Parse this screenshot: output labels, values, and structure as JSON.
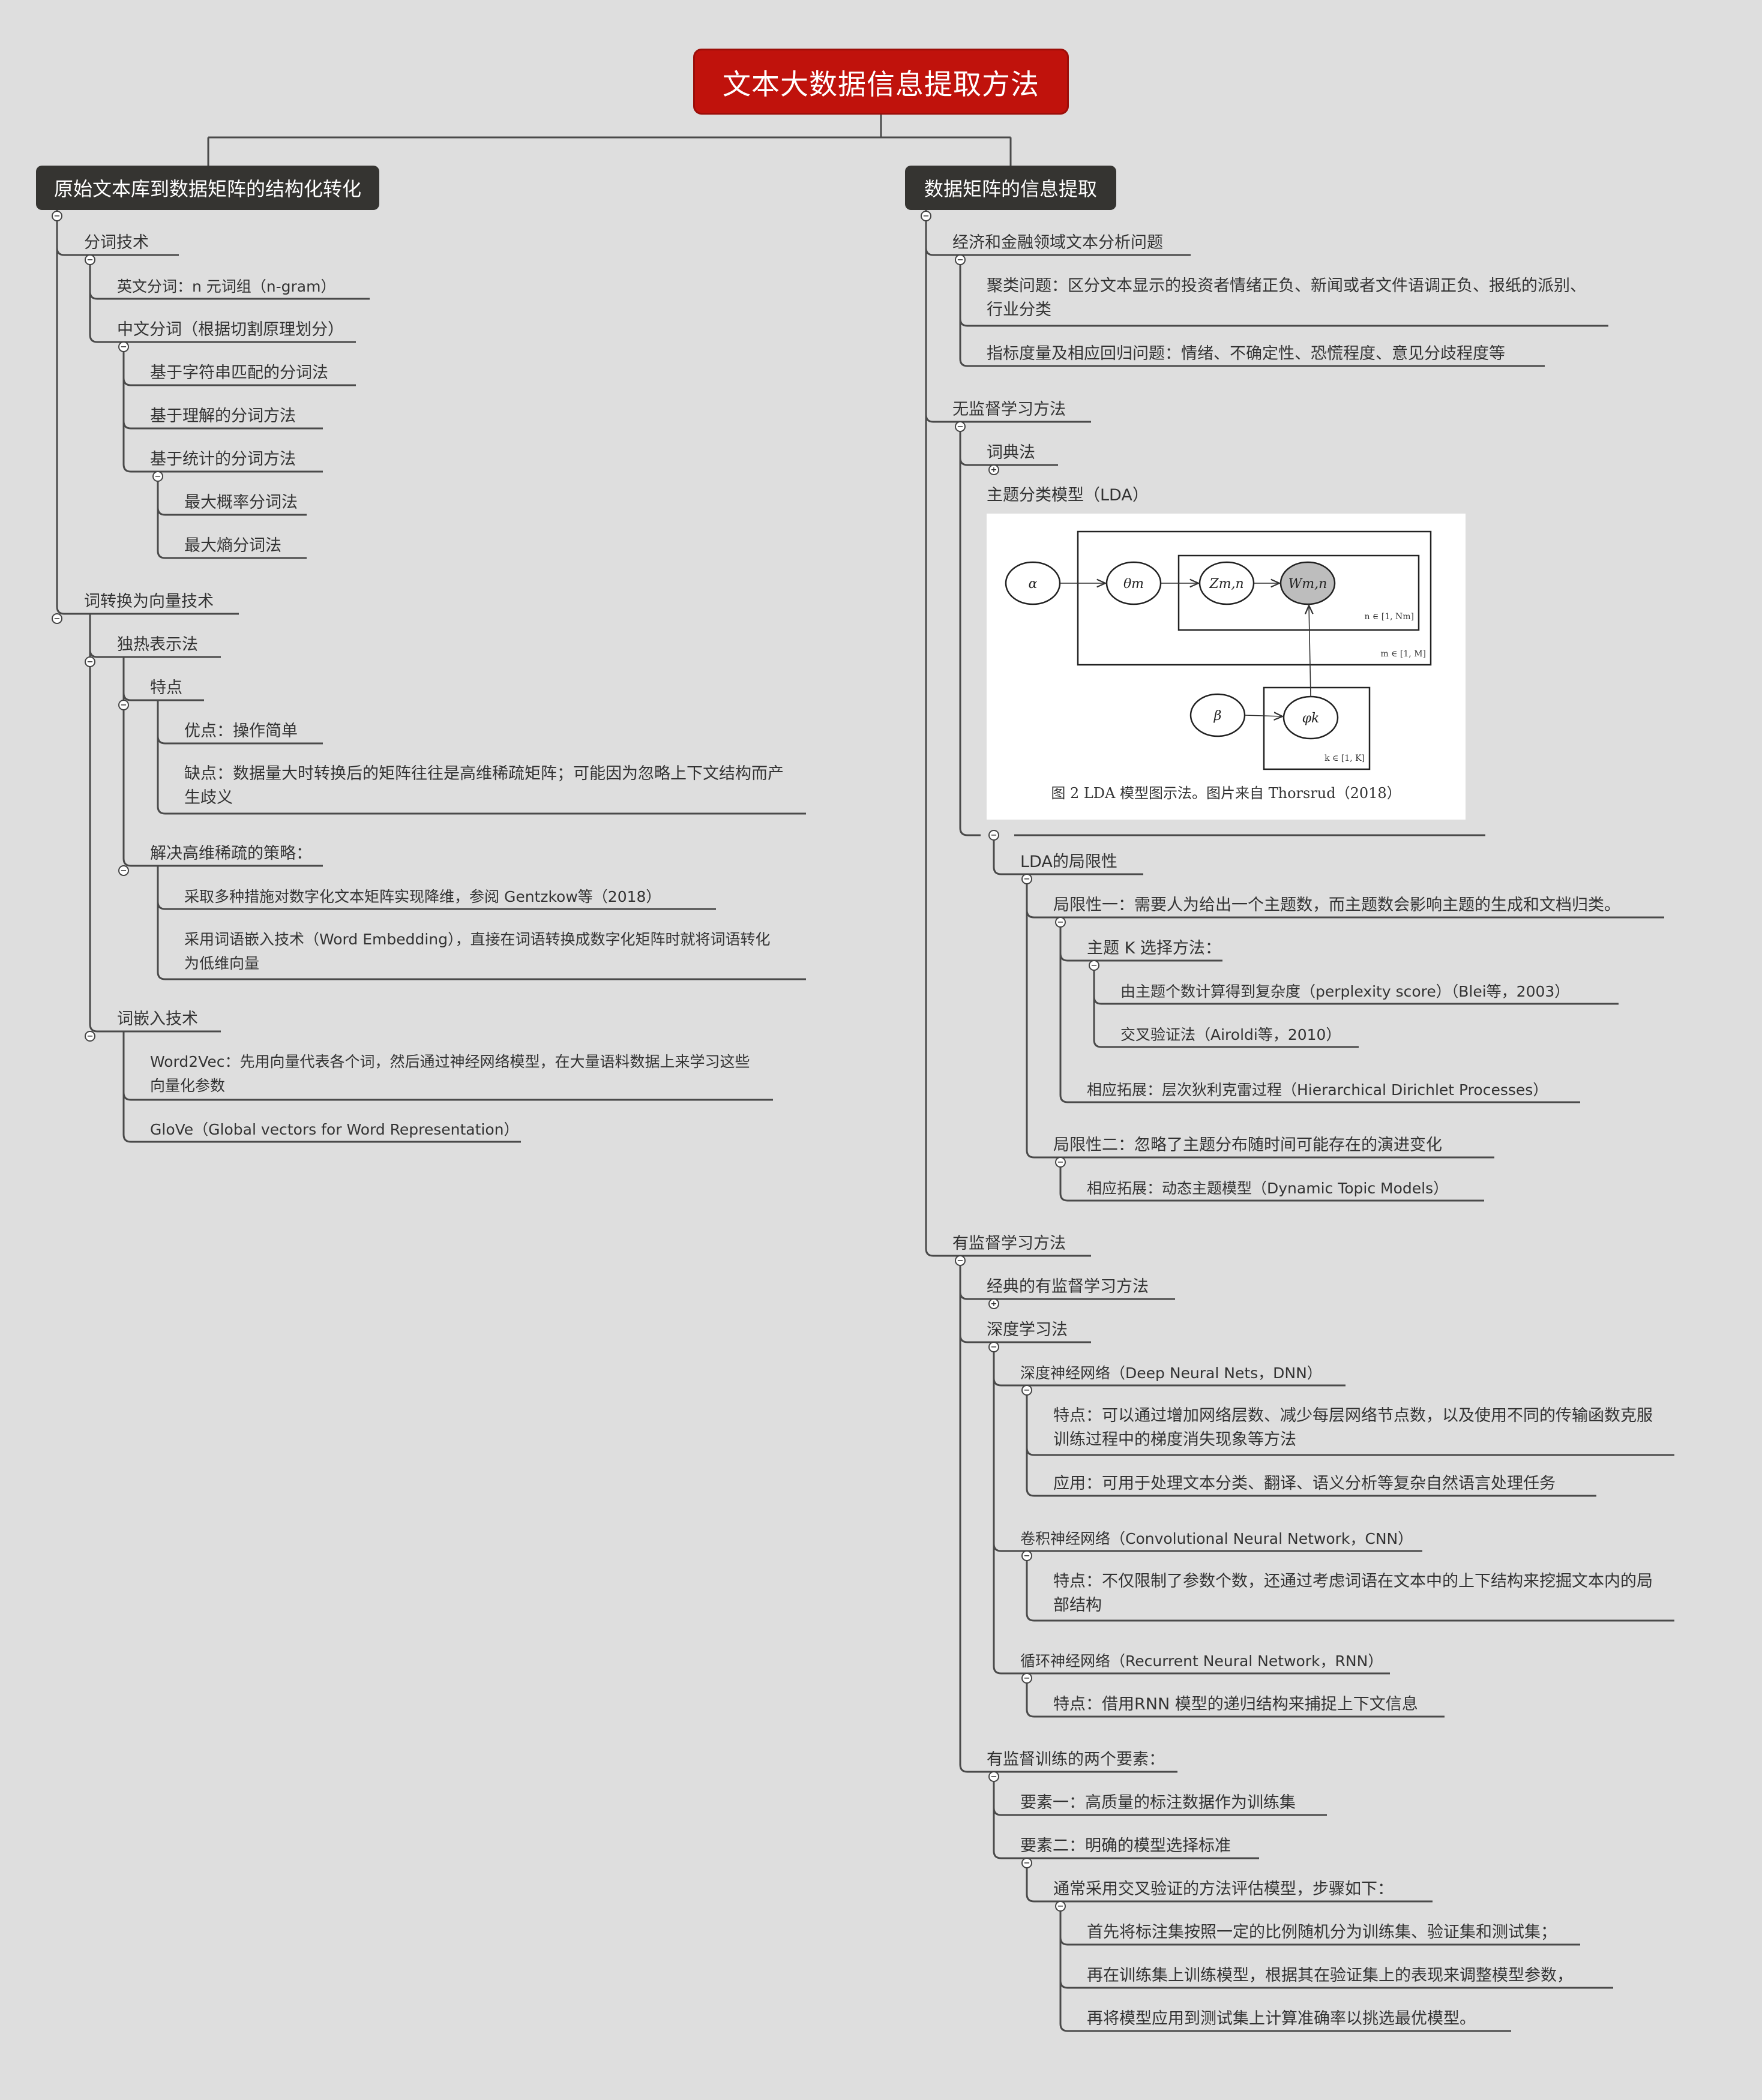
{
  "root": "文本大数据信息提取方法",
  "left": {
    "title": "原始文本库到数据矩阵的结构化转化",
    "segmentation": {
      "label": "分词技术",
      "english": "英文分词：n 元词组（n-gram）",
      "chinese": "中文分词（根据切割原理划分）",
      "string_match": "基于字符串匹配的分词法",
      "understanding": "基于理解的分词方法",
      "statistics": "基于统计的分词方法",
      "max_prob": "最大概率分词法",
      "max_entropy": "最大熵分词法"
    },
    "vectorize": {
      "label": "词转换为向量技术",
      "onehot": "独热表示法",
      "features": "特点",
      "pro": "优点：操作简单",
      "con": "缺点：数据量大时转换后的矩阵往往是高维稀疏矩阵；可能因为忽略上下文结构而产生歧义",
      "strategy": "解决高维稀疏的策略：",
      "strategy_1": "采取多种措施对数字化文本矩阵实现降维，参阅 Gentzkow等（2018）",
      "strategy_2": "采用词语嵌入技术（Word Embedding），直接在词语转换成数字化矩阵时就将词语转化为低维向量",
      "embedding": "词嵌入技术",
      "word2vec": "Word2Vec：先用向量代表各个词，然后通过神经网络模型，在大量语料数据上来学习这些向量化参数",
      "glove": "GloVe（Global vectors for Word Representation）"
    }
  },
  "right": {
    "title": "数据矩阵的信息提取",
    "econ": {
      "label": "经济和金融领域文本分析问题",
      "cluster": "聚类问题：区分文本显示的投资者情绪正负、新闻或者文件语调正负、报纸的派别、行业分类",
      "index": "指标度量及相应回归问题：情绪、不确定性、恐慌程度、意见分歧程度等"
    },
    "unsupervised": {
      "label": "无监督学习方法",
      "dictionary": "词典法",
      "topic": "主题分类模型（LDA）",
      "lda_figure": {
        "alpha": "α",
        "theta": "θm",
        "z": "Zm,n",
        "w": "Wm,n",
        "beta": "β",
        "phi": "φk",
        "plate_n": "n ∈ [1, Nm]",
        "plate_m": "m ∈ [1, M]",
        "plate_k": "k ∈ [1, K]",
        "caption": "图 2 LDA 模型图示法。图片来自 Thorsrud（2018）"
      },
      "limits": "LDA的局限性",
      "limit_1": "局限性一：需要人为给出一个主题数，而主题数会影响主题的生成和文档归类。",
      "k_method": "主题 K 选择方法：",
      "perplexity": "由主题个数计算得到复杂度（perplexity score）（Blei等，2003）",
      "cross_val": "交叉验证法（Airoldi等，2010）",
      "hdp": "相应拓展：层次狄利克雷过程（Hierarchical Dirichlet Processes）",
      "limit_2": "局限性二：忽略了主题分布随时间可能存在的演进变化",
      "dtm": "相应拓展：动态主题模型（Dynamic Topic Models）"
    },
    "supervised": {
      "label": "有监督学习方法",
      "classic": "经典的有监督学习方法",
      "deep": "深度学习法",
      "dnn": "深度神经网络（Deep Neural Nets，DNN）",
      "dnn_feat": "特点：可以通过增加网络层数、减少每层网络节点数，以及使用不同的传输函数克服训练过程中的梯度消失现象等方法",
      "dnn_app": "应用：可用于处理文本分类、翻译、语义分析等复杂自然语言处理任务",
      "cnn": "卷积神经网络（Convolutional Neural Network，CNN）",
      "cnn_feat": "特点：不仅限制了参数个数，还通过考虑词语在文本中的上下结构来挖掘文本内的局部结构",
      "rnn": "循环神经网络（Recurrent Neural Network，RNN）",
      "rnn_feat": "特点：借用RNN 模型的递归结构来捕捉上下文信息",
      "elements": "有监督训练的两个要素：",
      "element_1": "要素一：高质量的标注数据作为训练集",
      "element_2": "要素二：明确的模型选择标准",
      "cv_steps": "通常采用交叉验证的方法评估模型，步骤如下：",
      "step_1": "首先将标注集按照一定的比例随机分为训练集、验证集和测试集；",
      "step_2": "再在训练集上训练模型，根据其在验证集上的表现来调整模型参数，",
      "step_3": "再将模型应用到测试集上计算准确率以挑选最优模型。"
    }
  },
  "colors": {
    "background": "#dedede",
    "root_fill": "#c0120c",
    "main_fill": "#353431",
    "line": "#4a4a4a",
    "text": "#333333"
  }
}
